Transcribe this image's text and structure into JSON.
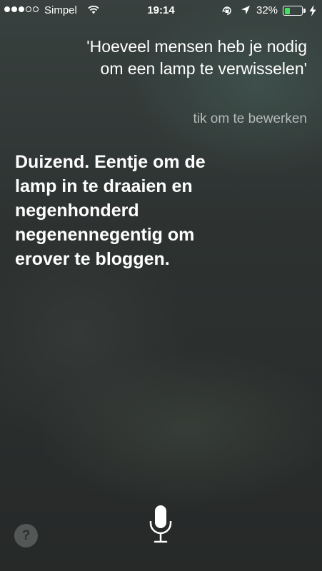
{
  "status_bar": {
    "signal_bars_filled": 3,
    "signal_bars_total": 5,
    "carrier": "Simpel",
    "time": "19:14",
    "battery_percent": "32%",
    "battery_level": 0.32,
    "battery_color": "#4cd964",
    "icons": [
      "wifi-icon",
      "orientation-lock-icon",
      "location-arrow-icon",
      "battery-icon",
      "charging-bolt-icon"
    ]
  },
  "siri": {
    "query_text": "'Hoeveel mensen heb je nodig om een lamp te verwisselen'",
    "edit_hint": "tik om te bewerken",
    "answer_text": "Duizend. Eentje om de lamp in te draaien en negenhonderd negenennegentig om erover te bloggen."
  },
  "controls": {
    "help_label": "?",
    "help_icon": "question-mark-icon",
    "mic_icon": "microphone-icon"
  }
}
